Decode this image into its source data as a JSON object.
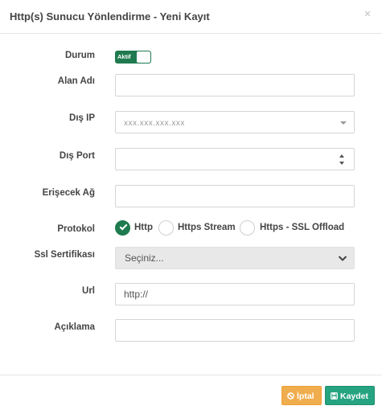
{
  "dialog": {
    "title": "Http(s) Sunucu Yönlendirme - Yeni Kayıt",
    "close_symbol": "×"
  },
  "form": {
    "status": {
      "label": "Durum",
      "toggle_text": "Aktif",
      "enabled": true
    },
    "domain": {
      "label": "Alan Adı",
      "value": ""
    },
    "external_ip": {
      "label": "Dış IP",
      "placeholder": "xxx.xxx.xxx.xxx",
      "icon": "caret-down-icon"
    },
    "external_port": {
      "label": "Dış Port",
      "value": ""
    },
    "target_network": {
      "label": "Erişecek Ağ",
      "value": ""
    },
    "protocol": {
      "label": "Protokol",
      "options": [
        "Http",
        "Https Stream",
        "Https - SSL Offload"
      ],
      "selected": "Http"
    },
    "ssl_certificate": {
      "label": "Ssl Sertifikası",
      "selected": "Seçiniz..."
    },
    "url": {
      "label": "Url",
      "value": "http://"
    },
    "description": {
      "label": "Açıklama",
      "value": ""
    }
  },
  "footer": {
    "cancel_label": "İptal",
    "save_label": "Kaydet",
    "cancel_icon": "ban-icon",
    "save_icon": "floppy-disk-icon"
  },
  "colors": {
    "accent_green": "#1e7a4f",
    "cancel_orange": "#f0ad4e",
    "save_teal": "#26a380"
  }
}
